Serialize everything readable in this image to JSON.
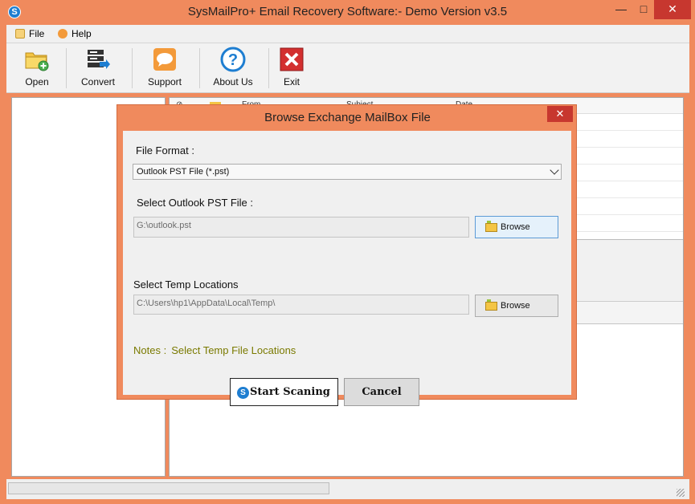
{
  "window": {
    "title": "SysMailPro+ Email Recovery Software:- Demo Version v3.5",
    "app_icon_letter": "S",
    "minimize": "—",
    "maximize": "□",
    "close": "✕"
  },
  "menu": {
    "file": "File",
    "help": "Help"
  },
  "toolbar": {
    "open": "Open",
    "convert": "Convert",
    "support": "Support",
    "about": "About Us",
    "exit": "Exit"
  },
  "list": {
    "columns": [
      "From",
      "Subject",
      "Date"
    ]
  },
  "dialog": {
    "title": "Browse Exchange MailBox File",
    "close": "✕",
    "file_format_label": "File Format :",
    "file_format_value": "Outlook PST File (*.pst)",
    "select_pst_label": "Select Outlook PST File :",
    "pst_path": "G:\\outlook.pst",
    "browse": "Browse",
    "temp_label": "Select Temp Locations",
    "temp_path": "C:\\Users\\hp1\\AppData\\Local\\Temp\\",
    "notes_prefix": "Notes :",
    "notes_text": "Select Temp File Locations",
    "start_button": "Start Scaning",
    "start_icon_letter": "S",
    "cancel_button": "Cancel"
  },
  "colors": {
    "frame": "#f08a5d",
    "close_red": "#c7372f",
    "note_olive": "#7a7a00"
  }
}
